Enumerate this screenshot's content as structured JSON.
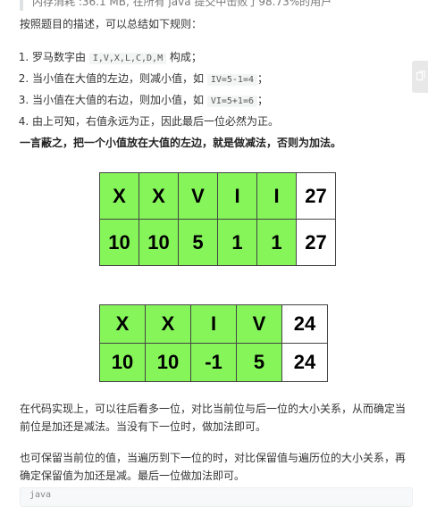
{
  "quote": {
    "text": "内存消耗 :36.1 MB, 在所有 java 提交中击败了98.73%的用户"
  },
  "intro": "按照题目的描述，可以总结如下规则：",
  "rules": [
    {
      "before": "罗马数字由 ",
      "code": "I,V,X,L,C,D,M",
      "after": " 构成；"
    },
    {
      "before": "当小值在大值的左边，则减小值，如 ",
      "code": "IV=5-1=4",
      "after": "；"
    },
    {
      "before": "当小值在大值的右边，则加小值，如 ",
      "code": "VI=5+1=6",
      "after": "；"
    },
    {
      "before": "由上可知，右值永远为正，因此最后一位必然为正。",
      "code": "",
      "after": ""
    }
  ],
  "summary": "一言蔽之，把一个小值放在大值的左边，就是做减法，否则为加法。",
  "table_a": {
    "letters": [
      "X",
      "X",
      "V",
      "I",
      "I"
    ],
    "values": [
      "10",
      "10",
      "5",
      "1",
      "1"
    ],
    "total_top": "27",
    "total_bottom": "27"
  },
  "table_b": {
    "letters": [
      "X",
      "X",
      "I",
      "V"
    ],
    "values": [
      "10",
      "10",
      "-1",
      "5"
    ],
    "total_top": "24",
    "total_bottom": "24"
  },
  "para_1": "在代码实现上，可以往后看多一位，对比当前位与后一位的大小关系，从而确定当前位是加还是减法。当没有下一位时，做加法即可。",
  "para_2": "也可保留当前位的值，当遍历到下一位的时，对比保留值与遍历位的大小关系，再确定保留值为加还是减。最后一位做加法即可。",
  "code_lang": "java",
  "colors": {
    "cell_green": "#86f55a",
    "cell_white": "#ffffff",
    "quote_bar": "#dfe2e5"
  },
  "icons": {
    "side_tab": "copy-icon"
  }
}
